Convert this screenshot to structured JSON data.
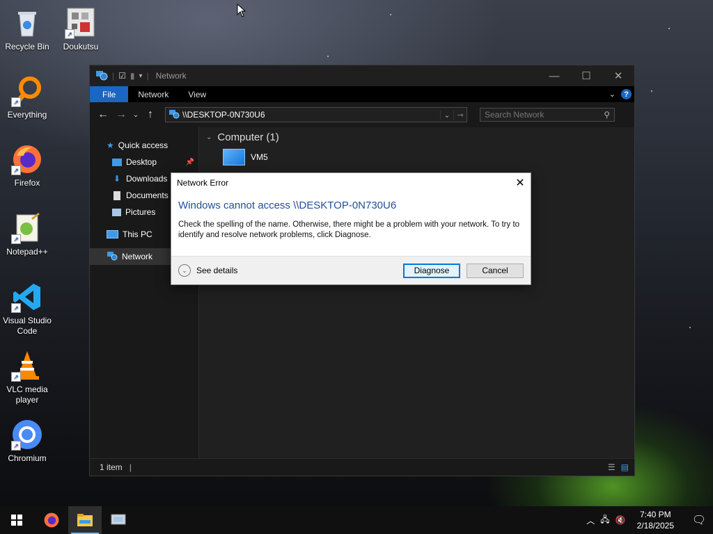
{
  "desktop": {
    "icons": [
      {
        "label": "Recycle Bin",
        "icon": "recycle-bin-icon"
      },
      {
        "label": "Doukutsu",
        "icon": "doukutsu-icon"
      },
      {
        "label": "Everything",
        "icon": "everything-search-icon"
      },
      {
        "label": "Firefox",
        "icon": "firefox-icon"
      },
      {
        "label": "Notepad++",
        "icon": "notepadpp-icon"
      },
      {
        "label": "Visual Studio Code",
        "icon": "vscode-icon"
      },
      {
        "label": "VLC media player",
        "icon": "vlc-icon"
      },
      {
        "label": "Chromium",
        "icon": "chromium-icon"
      }
    ]
  },
  "explorer": {
    "title": "Network",
    "ribbon_tabs": [
      "File",
      "Network",
      "View"
    ],
    "address": "\\\\DESKTOP-0N730U6",
    "search_placeholder": "Search Network",
    "nav": [
      {
        "label": "Quick access"
      },
      {
        "label": "Desktop"
      },
      {
        "label": "Downloads"
      },
      {
        "label": "Documents"
      },
      {
        "label": "Pictures"
      },
      {
        "label": "This PC"
      },
      {
        "label": "Network"
      }
    ],
    "group_header": "Computer (1)",
    "items": [
      {
        "label": "VM5"
      }
    ],
    "status": "1 item"
  },
  "dialog": {
    "title": "Network Error",
    "heading": "Windows cannot access \\\\DESKTOP-0N730U6",
    "message": "Check the spelling of the name. Otherwise, there might be a problem with your network. To try to identify and resolve network problems, click Diagnose.",
    "see_details": "See details",
    "diagnose": "Diagnose",
    "cancel": "Cancel"
  },
  "taskbar": {
    "time": "7:40 PM",
    "date": "2/18/2025"
  },
  "colors": {
    "accent": "#1a66c2",
    "dialog_heading": "#1e4e9b"
  }
}
